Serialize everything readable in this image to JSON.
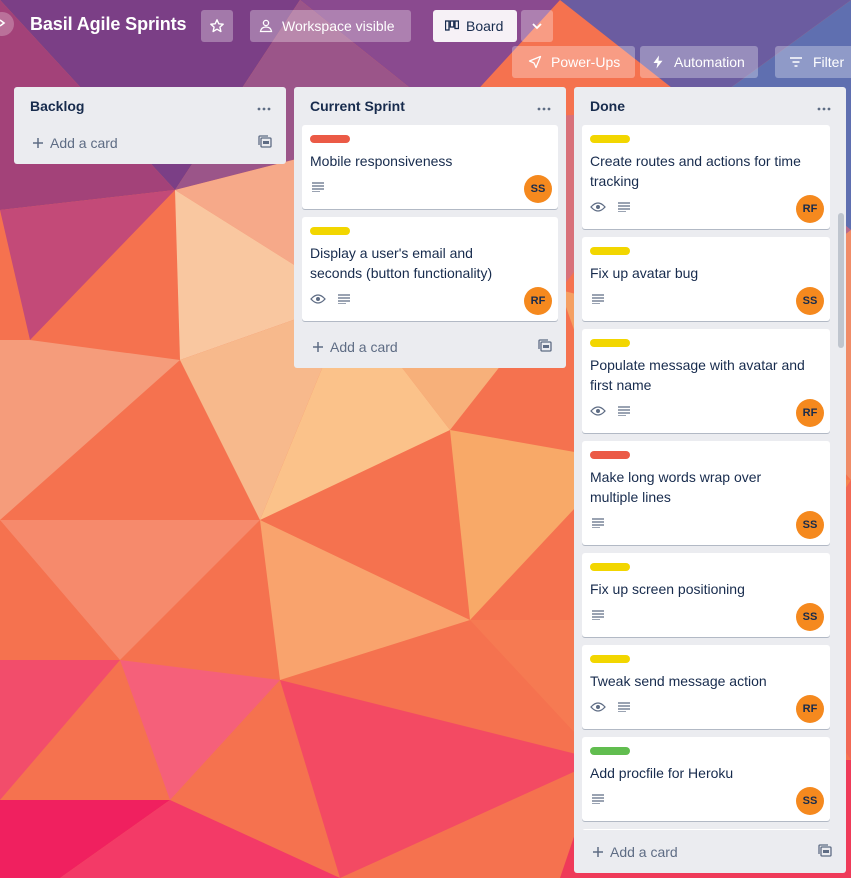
{
  "header": {
    "board_title": "Basil Agile Sprints",
    "visibility_label": "Workspace visible",
    "view_label": "Board",
    "powerups_label": "Power-Ups",
    "automation_label": "Automation",
    "filter_label": "Filter"
  },
  "colors": {
    "label_red": "#eb5a46",
    "label_yellow": "#f2d600",
    "label_green": "#61bd4f",
    "avatar": "#f5891e"
  },
  "lists": {
    "backlog": {
      "title": "Backlog",
      "add_card": "Add a card"
    },
    "current": {
      "title": "Current Sprint",
      "add_card": "Add a card",
      "cards": [
        {
          "label": "red",
          "title": "Mobile responsiveness",
          "watch": false,
          "avatar": "SS"
        },
        {
          "label": "yellow",
          "title": "Display a user's email and seconds (button functionality)",
          "watch": true,
          "avatar": "RF"
        }
      ]
    },
    "done": {
      "title": "Done",
      "add_card": "Add a card",
      "cards": [
        {
          "label": "yellow",
          "title": "Create routes and actions for time tracking",
          "watch": true,
          "avatar": "RF"
        },
        {
          "label": "yellow",
          "title": "Fix up avatar bug",
          "watch": false,
          "avatar": "SS"
        },
        {
          "label": "yellow",
          "title": "Populate message with avatar and first name",
          "watch": true,
          "avatar": "RF"
        },
        {
          "label": "red",
          "title": "Make long words wrap over multiple lines",
          "watch": false,
          "avatar": "SS"
        },
        {
          "label": "yellow",
          "title": "Fix up screen positioning",
          "watch": false,
          "avatar": "SS"
        },
        {
          "label": "yellow",
          "title": "Tweak send message action",
          "watch": true,
          "avatar": "RF"
        },
        {
          "label": "green",
          "title": "Add procfile for Heroku",
          "watch": false,
          "avatar": "SS"
        }
      ]
    }
  }
}
